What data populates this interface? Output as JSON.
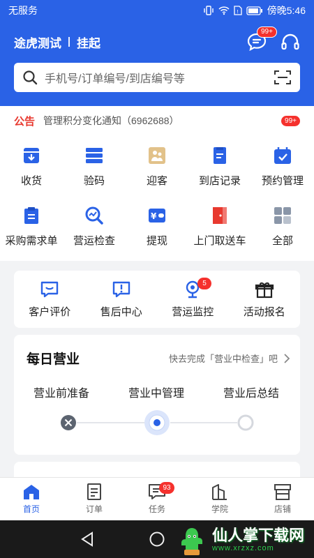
{
  "status_bar": {
    "carrier": "无服务",
    "time": "傍晚5:46"
  },
  "header": {
    "store_name": "途虎测试",
    "store_status": "挂起",
    "message_badge": "99+",
    "search_placeholder": "手机号/订单编号/到店编号等",
    "accent_color": "#2a62e6"
  },
  "notice": {
    "tag": "公告",
    "text": "管理积分变化通知（6962688）",
    "badge": "99+"
  },
  "grid": {
    "row1": [
      {
        "label": "收货",
        "icon": "receive-box-icon"
      },
      {
        "label": "验码",
        "icon": "verify-code-icon"
      },
      {
        "label": "迎客",
        "icon": "welcome-guest-icon"
      },
      {
        "label": "到店记录",
        "icon": "store-record-icon"
      },
      {
        "label": "预约管理",
        "icon": "appointment-icon"
      }
    ],
    "row2": [
      {
        "label": "采购需求单",
        "icon": "purchase-order-icon"
      },
      {
        "label": "营运检查",
        "icon": "operation-check-icon"
      },
      {
        "label": "提现",
        "icon": "withdraw-icon"
      },
      {
        "label": "上门取送车",
        "icon": "pickup-car-icon"
      },
      {
        "label": "全部",
        "icon": "all-apps-icon"
      }
    ]
  },
  "tools": [
    {
      "label": "客户评价",
      "icon": "review-icon"
    },
    {
      "label": "售后中心",
      "icon": "after-sales-icon"
    },
    {
      "label": "营运监控",
      "icon": "camera-icon",
      "badge": "5"
    },
    {
      "label": "活动报名",
      "icon": "gift-icon"
    }
  ],
  "daily": {
    "title": "每日营业",
    "hint": "快去完成「营业中检查」吧",
    "steps": [
      "营业前准备",
      "营业中管理",
      "营业后总结"
    ]
  },
  "tab_bar": [
    {
      "label": "首页",
      "icon": "home-icon",
      "active": true
    },
    {
      "label": "订单",
      "icon": "order-icon"
    },
    {
      "label": "任务",
      "icon": "task-icon",
      "badge": "93"
    },
    {
      "label": "学院",
      "icon": "academy-icon"
    },
    {
      "label": "店铺",
      "icon": "shop-icon"
    }
  ],
  "watermark": {
    "title": "仙人掌下载网",
    "url": "www.xrzxz.com"
  }
}
